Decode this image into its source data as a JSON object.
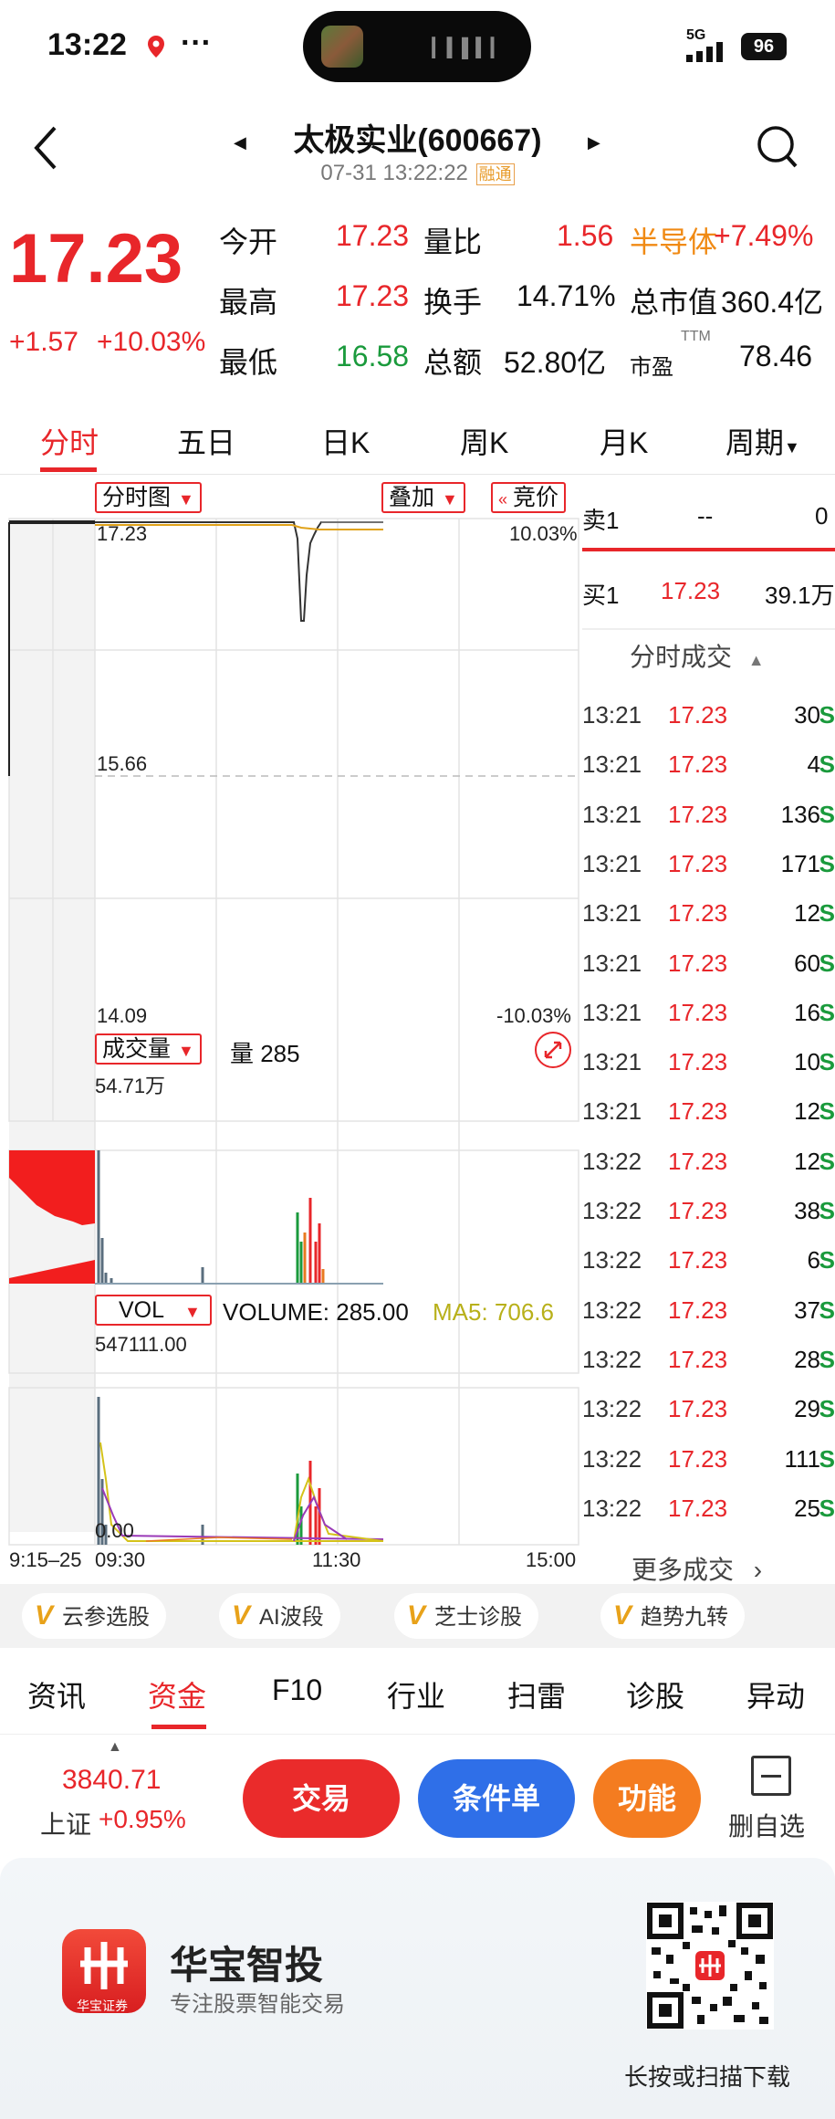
{
  "status": {
    "time": "13:22",
    "dots": "···",
    "network": "5G",
    "battery": "96"
  },
  "header": {
    "title": "太极实业(600667)",
    "datetime": "07-31 13:22:22",
    "badge": "融通"
  },
  "quote": {
    "price": "17.23",
    "change": "+1.57",
    "change_pct": "+10.03%",
    "fields": [
      {
        "label": "今开",
        "value": "17.23",
        "label2": "量比",
        "value2": "1.56"
      },
      {
        "label": "最高",
        "value": "17.23",
        "label2": "换手",
        "value2": "14.71%"
      },
      {
        "label": "最低",
        "value": "16.58",
        "label2": "总额",
        "value2": "52.80亿"
      }
    ],
    "sector": "半导体",
    "sector_pct": "+7.49%",
    "mcap_label": "总市值",
    "mcap": "360.4亿",
    "pe_label": "市盈",
    "pe_sup": "TTM",
    "pe": "78.46"
  },
  "period_tabs": [
    "分时",
    "五日",
    "日K",
    "周K",
    "月K",
    "周期"
  ],
  "chart": {
    "btn_main": "分时图",
    "btn_overlay": "叠加",
    "btn_auction": "竞价",
    "price_high": "17.23",
    "price_mid": "15.66",
    "price_low": "14.09",
    "pct_high": "10.03%",
    "pct_low": "-10.03%",
    "vol_btn": "成交量",
    "vol_label": "量 285",
    "vol_max": "54.71万",
    "ind_btn": "VOL",
    "ind_volume": "VOLUME: 285.00",
    "ind_ma5": "MA5: 706.6",
    "ind_max": "547111.00",
    "ind_min": "0.00",
    "time_axis": [
      "9:15–25",
      "09:30",
      "11:30",
      "15:00"
    ]
  },
  "orderbook": {
    "sell_label": "卖1",
    "sell_price": "--",
    "sell_vol": "0",
    "buy_label": "买1",
    "buy_price": "17.23",
    "buy_vol": "39.1万"
  },
  "ticks_header": "分时成交",
  "ticks": [
    {
      "t": "13:21",
      "p": "17.23",
      "v": "30"
    },
    {
      "t": "13:21",
      "p": "17.23",
      "v": "4"
    },
    {
      "t": "13:21",
      "p": "17.23",
      "v": "136"
    },
    {
      "t": "13:21",
      "p": "17.23",
      "v": "171"
    },
    {
      "t": "13:21",
      "p": "17.23",
      "v": "12"
    },
    {
      "t": "13:21",
      "p": "17.23",
      "v": "60"
    },
    {
      "t": "13:21",
      "p": "17.23",
      "v": "16"
    },
    {
      "t": "13:21",
      "p": "17.23",
      "v": "10"
    },
    {
      "t": "13:21",
      "p": "17.23",
      "v": "12"
    },
    {
      "t": "13:22",
      "p": "17.23",
      "v": "12"
    },
    {
      "t": "13:22",
      "p": "17.23",
      "v": "38"
    },
    {
      "t": "13:22",
      "p": "17.23",
      "v": "6"
    },
    {
      "t": "13:22",
      "p": "17.23",
      "v": "37"
    },
    {
      "t": "13:22",
      "p": "17.23",
      "v": "28"
    },
    {
      "t": "13:22",
      "p": "17.23",
      "v": "29"
    },
    {
      "t": "13:22",
      "p": "17.23",
      "v": "111"
    },
    {
      "t": "13:22",
      "p": "17.23",
      "v": "25"
    }
  ],
  "tick_flag": "S",
  "more": "更多成交",
  "features": [
    "云参选股",
    "AI波段",
    "芝士诊股",
    "趋势九转"
  ],
  "sections": [
    "资讯",
    "资金",
    "F10",
    "行业",
    "扫雷",
    "诊股",
    "异动"
  ],
  "index": {
    "value": "3840.71",
    "name": "上证",
    "pct": "+0.95%"
  },
  "actions": {
    "trade": "交易",
    "condition": "条件单",
    "func": "功能",
    "remove": "删自选"
  },
  "banner": {
    "brand": "华宝智投",
    "slogan": "专注股票智能交易",
    "logo_caption": "华宝证券",
    "scan": "长按或扫描下载"
  },
  "colors": {
    "up": "#e8262a",
    "down": "#1a9a3c",
    "accent": "#e8262a",
    "blue": "#2f6fe8",
    "orange": "#f47c20"
  }
}
